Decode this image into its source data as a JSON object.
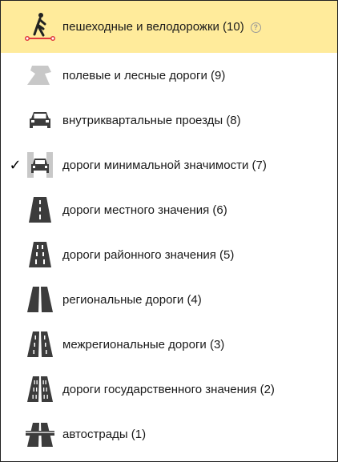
{
  "road_types": [
    {
      "label": "пешеходные и велодорожки (10)",
      "icon": "pedestrian-bicycle-path-icon",
      "highlighted": true,
      "checked": false,
      "help": "?"
    },
    {
      "label": "полевые и лесные дороги (9)",
      "icon": "dirt-road-icon",
      "highlighted": false,
      "checked": false
    },
    {
      "label": "внутриквартальные проезды (8)",
      "icon": "car-icon",
      "highlighted": false,
      "checked": false
    },
    {
      "label": "дороги минимальной значимости (7)",
      "icon": "car-road-icon",
      "highlighted": false,
      "checked": true,
      "check_mark": "✓"
    },
    {
      "label": "дороги местного значения (6)",
      "icon": "local-road-icon",
      "highlighted": false,
      "checked": false
    },
    {
      "label": "дороги районного значения (5)",
      "icon": "district-road-icon",
      "highlighted": false,
      "checked": false
    },
    {
      "label": "региональные дороги (4)",
      "icon": "regional-road-icon",
      "highlighted": false,
      "checked": false
    },
    {
      "label": "межрегиональные дороги (3)",
      "icon": "interregional-road-icon",
      "highlighted": false,
      "checked": false
    },
    {
      "label": "дороги государственного значения (2)",
      "icon": "national-road-icon",
      "highlighted": false,
      "checked": false
    },
    {
      "label": "автострады (1)",
      "icon": "highway-icon",
      "highlighted": false,
      "checked": false
    }
  ],
  "colors": {
    "highlight": "#ffeb9b",
    "icon_gray": "#3c3c3c",
    "text": "#1a1a1a",
    "path_accent": "#e0393c"
  }
}
